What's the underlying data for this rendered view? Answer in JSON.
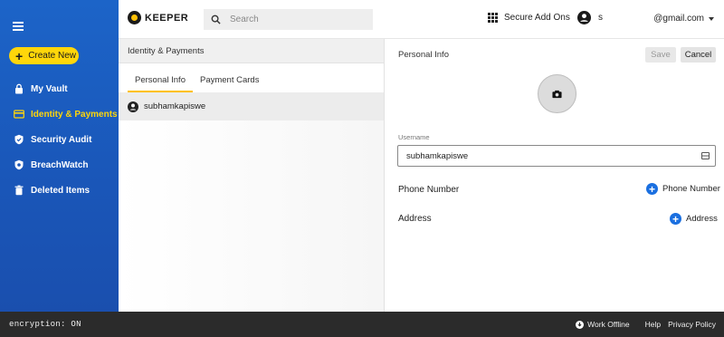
{
  "sidebar": {
    "create_label": "Create New",
    "items": [
      {
        "label": "My Vault",
        "icon": "lock-icon"
      },
      {
        "label": "Identity & Payments",
        "icon": "card-icon",
        "active": true
      },
      {
        "label": "Security Audit",
        "icon": "shield-icon"
      },
      {
        "label": "BreachWatch",
        "icon": "breachwatch-shield-icon"
      },
      {
        "label": "Deleted Items",
        "icon": "trash-icon"
      }
    ],
    "accent_color": "#ffd60a",
    "background_color": "#1a56b8"
  },
  "header": {
    "logo_text": "KEEPER",
    "search_placeholder": "Search",
    "addons_label": "Secure Add Ons",
    "user_initial": "s",
    "email": "@gmail.com"
  },
  "middle": {
    "title": "Identity & Payments",
    "tabs": [
      {
        "label": "Personal Info",
        "active": true
      },
      {
        "label": "Payment Cards",
        "active": false
      }
    ],
    "rows": [
      {
        "label": "subhamkapiswe"
      }
    ]
  },
  "detail": {
    "section_title": "Personal Info",
    "save_label": "Save",
    "cancel_label": "Cancel",
    "username_label": "Username",
    "username_value": "subhamkapiswe",
    "phone_label": "Phone Number",
    "phone_add_label": "Phone Number",
    "address_label": "Address",
    "address_add_label": "Address",
    "add_icon_color": "#1a6fe0"
  },
  "footer": {
    "encryption": "encryption: ON",
    "work_offline": "Work Offline",
    "help": "Help",
    "privacy": "Privacy Policy"
  }
}
